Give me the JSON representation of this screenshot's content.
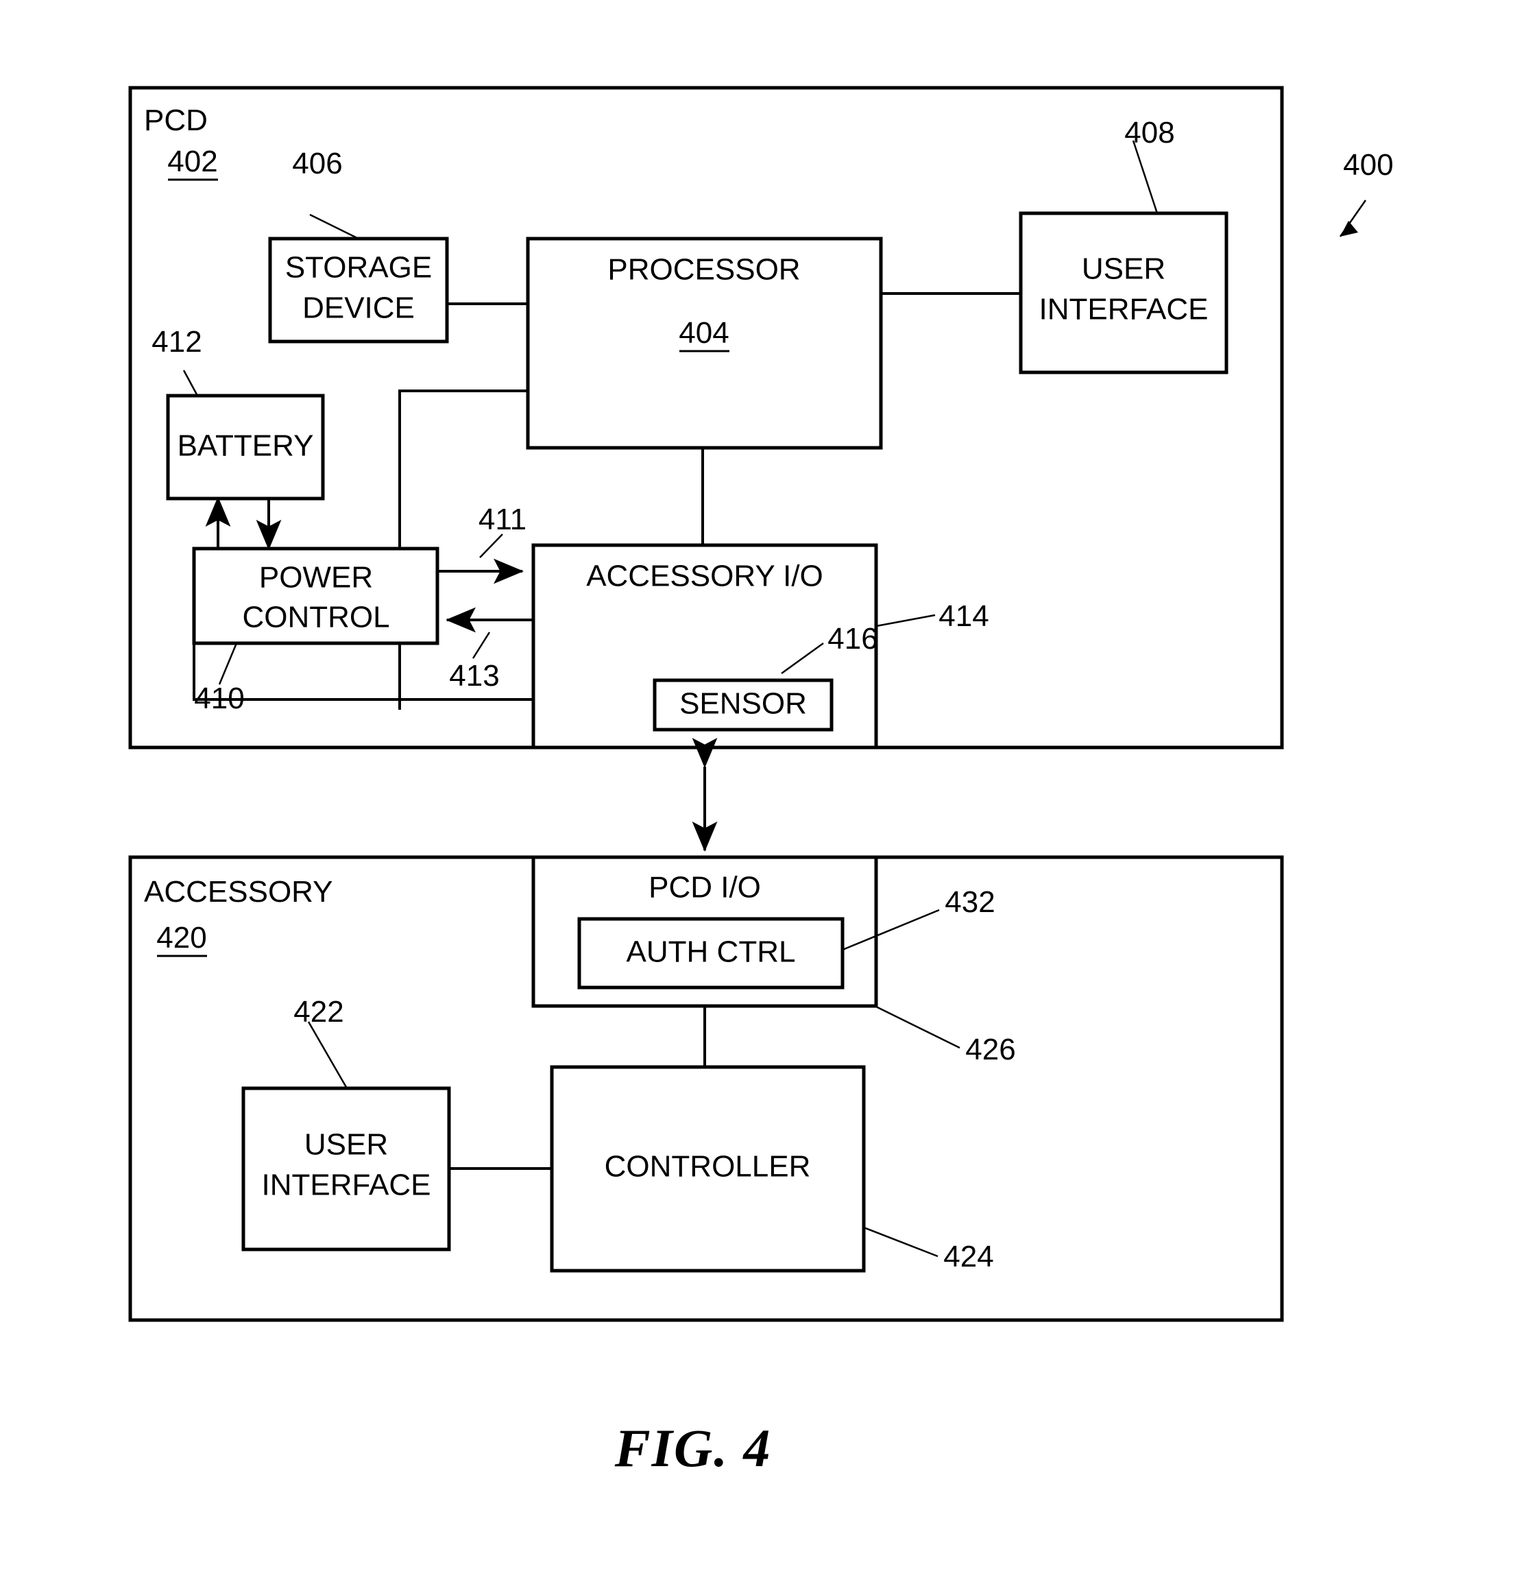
{
  "figure": {
    "caption": "FIG. 4",
    "system_ref": "400"
  },
  "pcd": {
    "title": "PCD",
    "ref": "402",
    "blocks": {
      "storage_device": {
        "line1": "STORAGE",
        "line2": "DEVICE",
        "ref": "406"
      },
      "processor": {
        "label": "PROCESSOR",
        "ref": "404"
      },
      "user_interface": {
        "line1": "USER",
        "line2": "INTERFACE",
        "ref": "408"
      },
      "battery": {
        "label": "BATTERY",
        "ref": "412"
      },
      "power_control": {
        "line1": "POWER",
        "line2": "CONTROL",
        "ref": "410"
      },
      "accessory_io": {
        "label": "ACCESSORY I/O",
        "ref": "414"
      },
      "sensor": {
        "label": "SENSOR",
        "ref": "416"
      }
    },
    "signals": {
      "power_out": "411",
      "power_in": "413"
    }
  },
  "accessory": {
    "title": "ACCESSORY",
    "ref": "420",
    "blocks": {
      "pcd_io": {
        "label": "PCD I/O",
        "ref": "426"
      },
      "auth_ctrl": {
        "label": "AUTH CTRL",
        "ref": "432"
      },
      "user_interface": {
        "line1": "USER",
        "line2": "INTERFACE",
        "ref": "422"
      },
      "controller": {
        "label": "CONTROLLER",
        "ref": "424"
      }
    }
  }
}
